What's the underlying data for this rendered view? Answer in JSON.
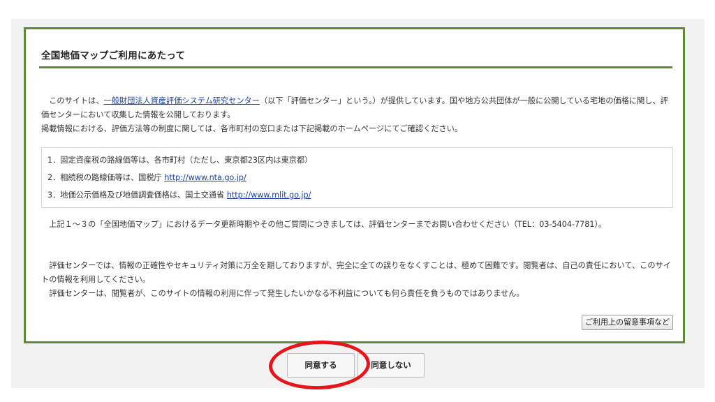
{
  "dialog": {
    "title": "全国地価マップご利用にあたって",
    "intro": {
      "line1_pre": "　このサイトは、",
      "line1_link": "一般財団法人資産評価システム研究センター",
      "line1_post": "（以下「評価センター」という。）が提供しています。国や地方公共団体が一般に公開している宅地の価格に関し、評価センターにおいて収集した情報を公開しております。",
      "line2": "掲載情報における、評価方法等の制度に関しては、各市町村の窓口または下記掲載のホームページにてご確認ください。"
    },
    "list": [
      {
        "text": "1．固定資産税の路線価等は、各市町村（ただし、東京都23区内は東京都）",
        "link": ""
      },
      {
        "text": "2．相続税の路線価等は、国税庁 ",
        "link": "http://www.nta.go.jp/"
      },
      {
        "text": "3．地価公示価格及び地価調査価格は、国土交通省 ",
        "link": "http://www.mlit.go.jp/"
      }
    ],
    "contact": "　上記１～３の「全国地価マップ」におけるデータ更新時期やその他ご質問につきましては、評価センターまでお問い合わせください（TEL：03-5404-7781）。",
    "disclaimer1": "　評価センターでは、情報の正確性やセキュリティ対策に万全を期しておりますが、完全に全ての誤りをなくすことは、極めて困難です。閲覧者は、自己の責任において、このサイトの情報を利用してください。",
    "disclaimer2": "　評価センターは、閲覧者が、このサイトの情報の利用に伴って発生したいかなる不利益についても何ら責任を負うものではありません。",
    "notes_button": "ご利用上の留意事項など"
  },
  "buttons": {
    "agree": "同意する",
    "disagree": "同意しない"
  },
  "highlight": {
    "target": "agree",
    "color": "#e8141c"
  },
  "colors": {
    "panel_border": "#5f8a3a",
    "link": "#1a3fa8"
  }
}
